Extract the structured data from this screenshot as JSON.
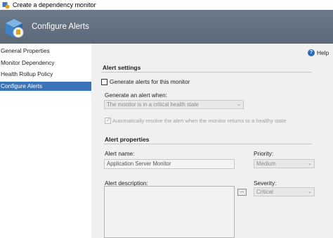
{
  "window": {
    "title": "Create a dependency monitor"
  },
  "banner": {
    "title": "Configure Alerts"
  },
  "nav": {
    "items": [
      {
        "label": "General Properties"
      },
      {
        "label": "Monitor Dependency"
      },
      {
        "label": "Health Rollup Policy"
      },
      {
        "label": "Configure Alerts"
      }
    ],
    "active_index": 3
  },
  "help": {
    "label": "Help"
  },
  "alert_settings": {
    "title": "Alert settings",
    "generate_checkbox_label": "Generate alerts for this monitor",
    "generate_checked": false,
    "when_label": "Generate an alert when:",
    "when_value": "The monitor is in a critical health state",
    "auto_resolve_label": "Automatically resolve the alert when the monitor returns to a healthy state",
    "auto_resolve_checked": true
  },
  "alert_properties": {
    "title": "Alert properties",
    "name_label": "Alert name:",
    "name_value": "Application Server Monitor",
    "priority_label": "Priority:",
    "priority_value": "Medium",
    "description_label": "Alert description:",
    "description_value": "",
    "ellipsis_label": "...",
    "severity_label": "Severity:",
    "severity_value": "Critical"
  },
  "colors": {
    "banner": "#5b6878",
    "nav_active": "#3b73b9",
    "window_bg": "#f0f0f0"
  }
}
